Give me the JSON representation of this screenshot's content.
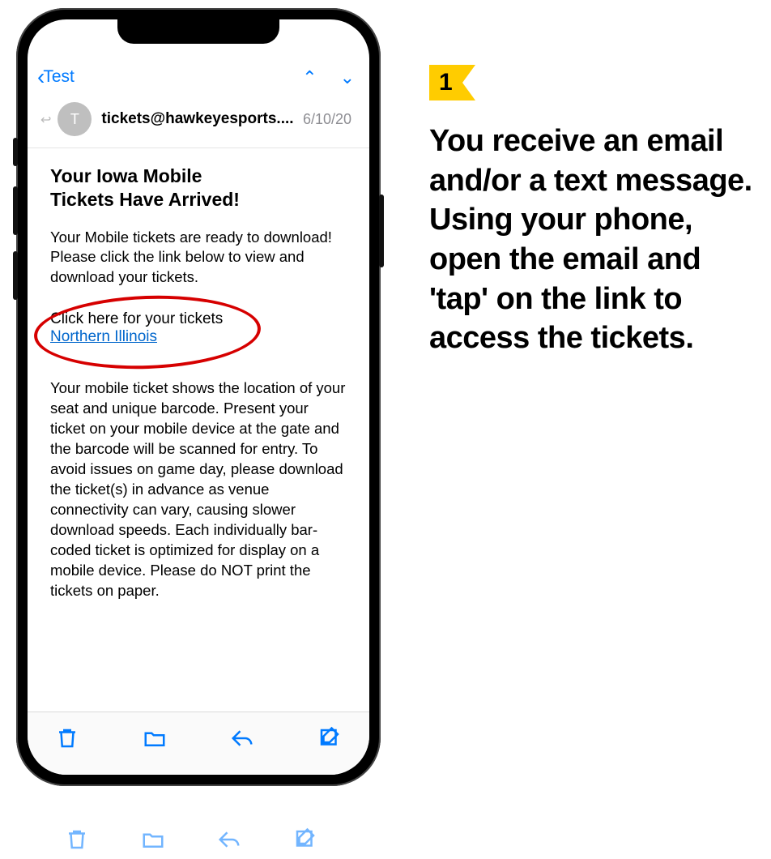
{
  "step": {
    "number": "1",
    "text": "You receive an email and/or a text message. Using your phone, open the email and 'tap' on the link to access the tickets."
  },
  "mail": {
    "back_label": "Test",
    "avatar_initial": "T",
    "sender": "tickets@hawkeyesports....",
    "date": "6/10/20",
    "subject_line1": "Your Iowa Mobile",
    "subject_line2": "Tickets Have Arrived!",
    "intro": "Your Mobile tickets are ready to download! Please click the link below to view and download your tickets.",
    "link_caption": "Click here for your tickets",
    "link_text": "Northern Illinois",
    "details": "Your mobile ticket shows the location of your seat and unique barcode. Present your ticket on your mobile device at the gate and the barcode will be scanned for entry. To avoid issues on game day, please download the ticket(s) in advance as venue connectivity can vary, causing slower download speeds. Each individually bar-coded ticket is optimized for display on a mobile device. Please do NOT print the tickets on paper."
  },
  "colors": {
    "accent": "#007aff",
    "highlight": "#d60000",
    "badge": "#ffcc00"
  }
}
